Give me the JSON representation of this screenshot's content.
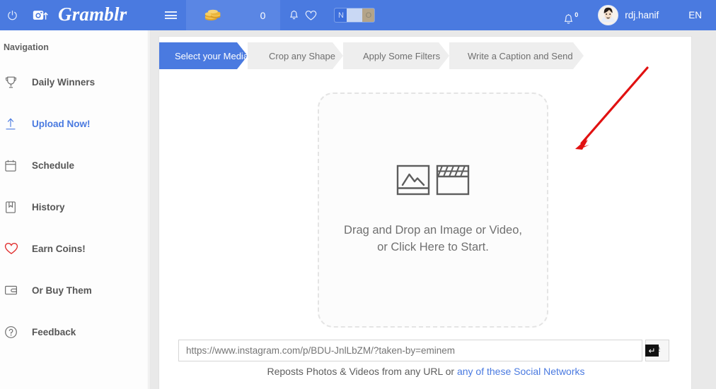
{
  "topbar": {
    "power_icon": "power-icon",
    "instagram_upload_icon": "instagram-upload-icon",
    "brand": "Gramblr",
    "menu_icon": "hamburger-menu-icon",
    "coin_icon": "coins-icon",
    "coin_count": "0",
    "notify_icon": "notification-bell-small-icon",
    "heart_icon": "heart-icon",
    "toggle": {
      "left_label": "N",
      "right_label": "O"
    },
    "bell_icon": "bell-icon",
    "bell_badge": "0",
    "avatar": "user-avatar",
    "username": "rdj.hanif",
    "language": "EN"
  },
  "sidebar": {
    "title": "Navigation",
    "items": [
      {
        "label": "Daily Winners",
        "icon": "trophy-icon",
        "active": false
      },
      {
        "label": "Upload Now!",
        "icon": "upload-arrow-icon",
        "active": true
      },
      {
        "label": "Schedule",
        "icon": "calendar-icon",
        "active": false
      },
      {
        "label": "History",
        "icon": "bookmark-icon",
        "active": false
      },
      {
        "label": "Earn Coins!",
        "icon": "heart-outline-icon",
        "active": false
      },
      {
        "label": "Or Buy Them",
        "icon": "wallet-icon",
        "active": false
      },
      {
        "label": "Feedback",
        "icon": "question-circle-icon",
        "active": false
      }
    ]
  },
  "main": {
    "steps": [
      {
        "label": "Select your Media",
        "active": true
      },
      {
        "label": "Crop any Shape",
        "active": false
      },
      {
        "label": "Apply Some Filters",
        "active": false
      },
      {
        "label": "Write a Caption and Send",
        "active": false
      }
    ],
    "dropzone": {
      "image_icon": "picture-icon",
      "video_icon": "clapperboard-icon",
      "line1": "Drag and Drop an Image or Video,",
      "line2": "or Click Here to Start."
    },
    "url": {
      "placeholder": "https://www.instagram.com/p/BDU-JnlLbZM/?taken-by=eminem",
      "value": "",
      "enter_icon": "enter-key-icon",
      "hashtag_label": "#"
    },
    "note": {
      "prefix": "Reposts Photos & Videos from any URL or ",
      "link": "any of these Social Networks"
    }
  },
  "annotation": {
    "arrow_color": "#e11111",
    "arrow_name": "red-pointer-arrow"
  },
  "colors": {
    "brand_blue": "#4a7ae0",
    "panel_bg": "#ffffff",
    "gray_bg": "#e9e9e9",
    "accent_red": "#e02b2b"
  }
}
